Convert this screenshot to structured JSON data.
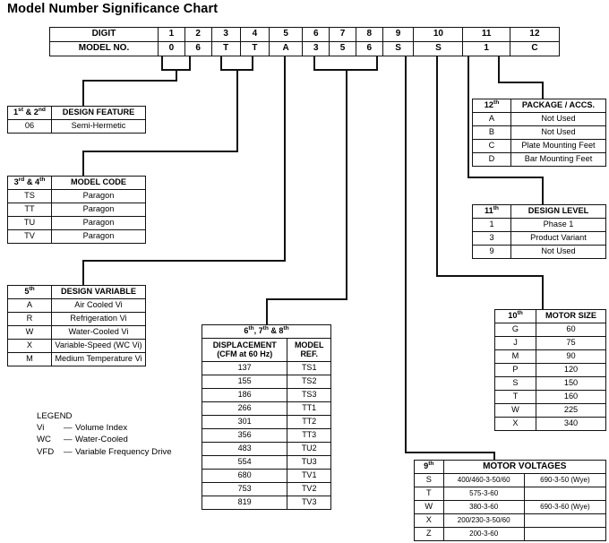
{
  "title": "Model Number Significance Chart",
  "top_table": {
    "row_labels": [
      "DIGIT",
      "MODEL NO."
    ],
    "digits": [
      "1",
      "2",
      "3",
      "4",
      "5",
      "6",
      "7",
      "8",
      "9",
      "10",
      "11",
      "12"
    ],
    "model_no": [
      "0",
      "6",
      "T",
      "T",
      "A",
      "3",
      "5",
      "6",
      "S",
      "S",
      "1",
      "C"
    ]
  },
  "design_feature": {
    "digit_label": "1st & 2nd",
    "digit_label_ord": [
      "1",
      "st",
      "& 2",
      "nd"
    ],
    "header": "DESIGN FEATURE",
    "rows": [
      {
        "code": "06",
        "desc": "Semi-Hermetic"
      }
    ]
  },
  "model_code": {
    "digit_label_ord": [
      "3",
      "rd",
      "& 4",
      "th"
    ],
    "header": "MODEL CODE",
    "rows": [
      {
        "code": "TS",
        "desc": "Paragon"
      },
      {
        "code": "TT",
        "desc": "Paragon"
      },
      {
        "code": "TU",
        "desc": "Paragon"
      },
      {
        "code": "TV",
        "desc": "Paragon"
      }
    ]
  },
  "design_variable": {
    "digit_label_ord": [
      "5",
      "th"
    ],
    "header": "DESIGN VARIABLE",
    "rows": [
      {
        "code": "A",
        "desc": "Air Cooled Vi"
      },
      {
        "code": "R",
        "desc": "Refrigeration Vi"
      },
      {
        "code": "W",
        "desc": "Water-Cooled Vi"
      },
      {
        "code": "X",
        "desc": "Variable-Speed (WC Vi)"
      },
      {
        "code": "M",
        "desc": "Medium Temperature Vi"
      }
    ]
  },
  "displacement": {
    "digit_label_ord": [
      "6",
      "th",
      ", 7",
      "th",
      "& 8",
      "th"
    ],
    "col1_line1": "DISPLACEMENT",
    "col1_line2": "(CFM at 60 Hz)",
    "col2_line1": "MODEL",
    "col2_line2": "REF.",
    "rows": [
      {
        "cfm": "137",
        "ref": "TS1"
      },
      {
        "cfm": "155",
        "ref": "TS2"
      },
      {
        "cfm": "186",
        "ref": "TS3"
      },
      {
        "cfm": "266",
        "ref": "TT1"
      },
      {
        "cfm": "301",
        "ref": "TT2"
      },
      {
        "cfm": "356",
        "ref": "TT3"
      },
      {
        "cfm": "483",
        "ref": "TU2"
      },
      {
        "cfm": "554",
        "ref": "TU3"
      },
      {
        "cfm": "680",
        "ref": "TV1"
      },
      {
        "cfm": "753",
        "ref": "TV2"
      },
      {
        "cfm": "819",
        "ref": "TV3"
      }
    ]
  },
  "package": {
    "digit_label_ord": [
      "12",
      "th"
    ],
    "header": "PACKAGE / ACCS.",
    "rows": [
      {
        "code": "A",
        "desc": "Not Used"
      },
      {
        "code": "B",
        "desc": "Not Used"
      },
      {
        "code": "C",
        "desc": "Plate Mounting Feet"
      },
      {
        "code": "D",
        "desc": "Bar Mounting Feet"
      }
    ]
  },
  "design_level": {
    "digit_label_ord": [
      "11",
      "th"
    ],
    "header": "DESIGN LEVEL",
    "rows": [
      {
        "code": "1",
        "desc": "Phase 1"
      },
      {
        "code": "3",
        "desc": "Product Variant"
      },
      {
        "code": "9",
        "desc": "Not Used"
      }
    ]
  },
  "motor_size": {
    "digit_label_ord": [
      "10",
      "th"
    ],
    "header": "MOTOR SIZE",
    "rows": [
      {
        "code": "G",
        "desc": "60"
      },
      {
        "code": "J",
        "desc": "75"
      },
      {
        "code": "M",
        "desc": "90"
      },
      {
        "code": "P",
        "desc": "120"
      },
      {
        "code": "S",
        "desc": "150"
      },
      {
        "code": "T",
        "desc": "160"
      },
      {
        "code": "W",
        "desc": "225"
      },
      {
        "code": "X",
        "desc": "340"
      }
    ]
  },
  "motor_voltages": {
    "digit_label_ord": [
      "9",
      "th"
    ],
    "header": "MOTOR VOLTAGES",
    "rows": [
      {
        "code": "S",
        "v1": "400/460-3-50/60",
        "v2": "690-3-50 (Wye)"
      },
      {
        "code": "T",
        "v1": "575-3-60",
        "v2": ""
      },
      {
        "code": "W",
        "v1": "380-3-60",
        "v2": "690-3-60 (Wye)"
      },
      {
        "code": "X",
        "v1": "200/230-3-50/60",
        "v2": ""
      },
      {
        "code": "Z",
        "v1": "200-3-60",
        "v2": ""
      }
    ]
  },
  "legend": {
    "title": "LEGEND",
    "entries": [
      {
        "abbr": "Vi",
        "dash": "—",
        "desc": "Volume Index"
      },
      {
        "abbr": "WC",
        "dash": "—",
        "desc": "Water-Cooled"
      },
      {
        "abbr": "VFD",
        "dash": "—",
        "desc": "Variable Frequency Drive"
      }
    ]
  }
}
